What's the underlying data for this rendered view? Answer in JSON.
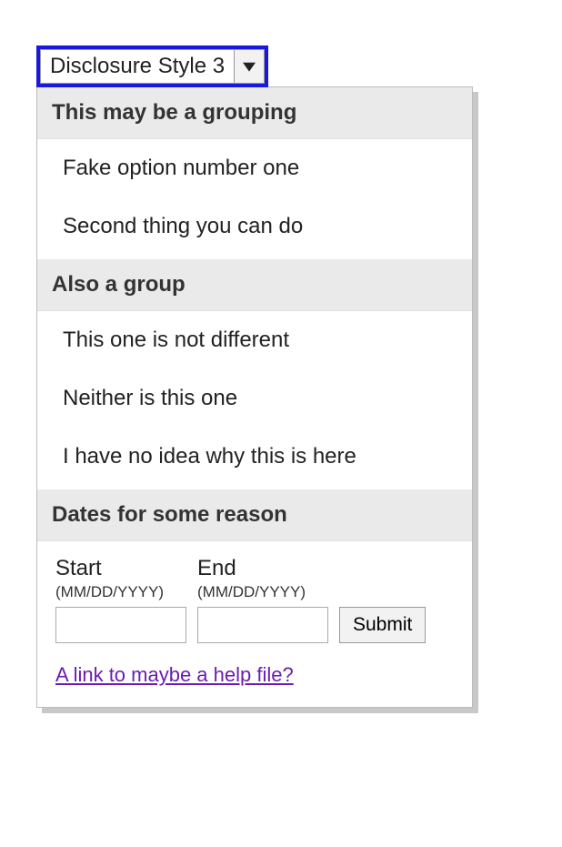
{
  "trigger": {
    "label": "Disclosure Style 3"
  },
  "panel": {
    "groups": [
      {
        "header": "This may be a grouping",
        "options": [
          "Fake option number one",
          "Second thing you can do"
        ]
      },
      {
        "header": "Also a group",
        "options": [
          "This one is not different",
          "Neither is this one",
          "I have no idea why this is here"
        ]
      }
    ],
    "date_section": {
      "header": "Dates for some reason",
      "start": {
        "label": "Start",
        "format": "(MM/DD/YYYY)",
        "value": ""
      },
      "end": {
        "label": "End",
        "format": "(MM/DD/YYYY)",
        "value": ""
      },
      "submit_label": "Submit"
    },
    "help_link": "A link to maybe a help file?"
  }
}
